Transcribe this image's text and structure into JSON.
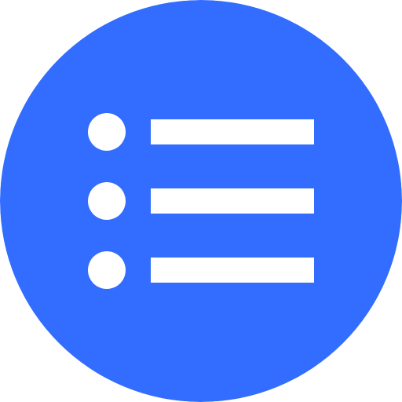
{
  "icon": {
    "name": "list-icon",
    "background_color": "#336DFF",
    "foreground_color": "#FFFFFF",
    "items": [
      {
        "name": "list-row-1"
      },
      {
        "name": "list-row-2"
      },
      {
        "name": "list-row-3"
      }
    ]
  }
}
